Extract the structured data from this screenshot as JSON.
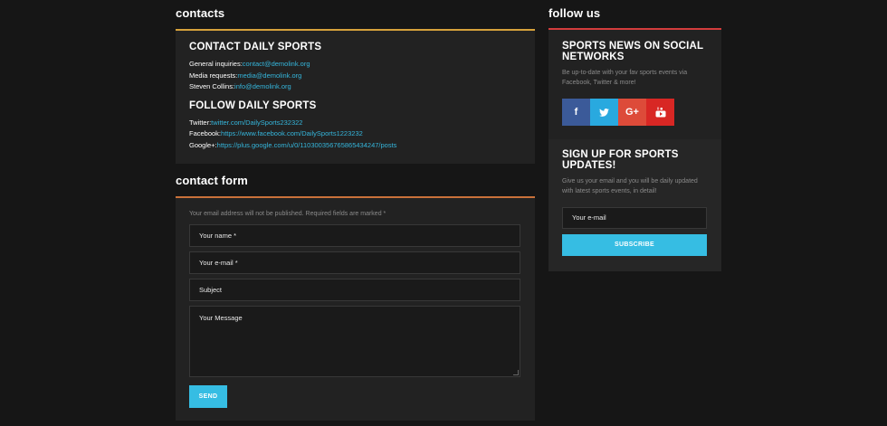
{
  "contacts": {
    "section_title": "contacts",
    "heading": "CONTACT DAILY SPORTS",
    "lines": [
      {
        "label": "General inquiries:",
        "value": "contact@demolink.org"
      },
      {
        "label": "Media requests:",
        "value": "media@demolink.org"
      },
      {
        "label": "Steven Collins:",
        "value": "info@demolink.org"
      }
    ],
    "follow_heading": "FOLLOW DAILY SPORTS",
    "follow_lines": [
      {
        "label": "Twitter:",
        "value": "twitter.com/DailySports232322"
      },
      {
        "label": "Facebook:",
        "value": "https://www.facebook.com/DailySports1223232"
      },
      {
        "label": "Google+:",
        "value": "https://plus.google.com/u/0/110300356765865434247/posts"
      }
    ]
  },
  "form": {
    "section_title": "contact form",
    "note": "Your email address will not be published. Required fields are marked *",
    "name_placeholder": "Your name *",
    "email_placeholder": "Your e-mail *",
    "subject_placeholder": "Subject",
    "message_placeholder": "Your Message",
    "send_label": "SEND"
  },
  "follow": {
    "section_title": "follow us",
    "heading": "SPORTS NEWS ON SOCIAL NETWORKS",
    "description": "Be up-to-date with your fav sports events via Facebook, Twitter & more!",
    "icons": [
      {
        "name": "facebook-icon",
        "glyph": "f",
        "color": "#3b5a99"
      },
      {
        "name": "twitter-icon",
        "glyph": "t",
        "color": "#29a9df"
      },
      {
        "name": "google-plus-icon",
        "glyph": "G+",
        "color": "#dd4b39"
      },
      {
        "name": "youtube-icon",
        "glyph": "▶",
        "color": "#d82724"
      }
    ]
  },
  "signup": {
    "heading": "SIGN UP FOR SPORTS UPDATES!",
    "description": "Give us your email and you will be daily updated with latest sports events, in detail!",
    "email_placeholder": "Your e-mail",
    "subscribe_label": "SUBSCRIBE"
  },
  "colors": {
    "accent": "#36bde3",
    "link": "#35b6dc",
    "contacts_border": "#d6a13b",
    "form_border": "#c9713a",
    "follow_border": "#d23c3c"
  }
}
